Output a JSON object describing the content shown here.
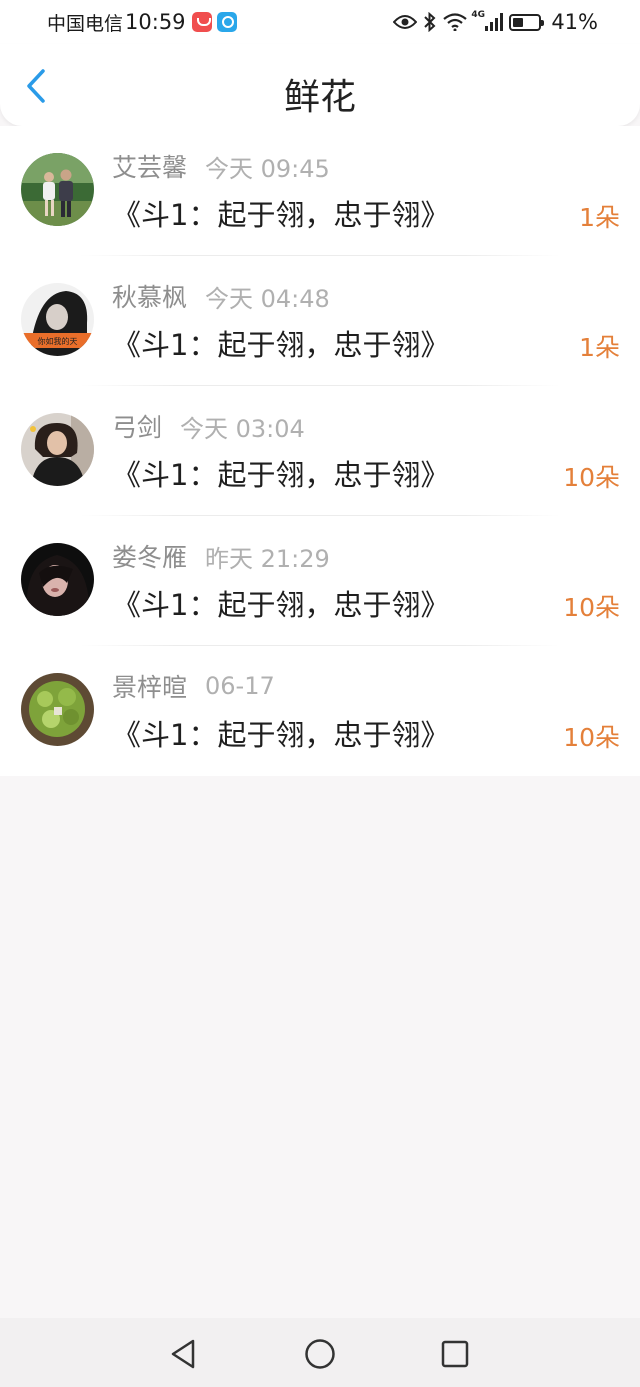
{
  "status_bar": {
    "carrier": "中国电信",
    "time": "10:59",
    "network": "4G",
    "battery_percent": "41%",
    "battery_level": 0.41
  },
  "header": {
    "title": "鲜花",
    "back_icon": "chevron-left-icon"
  },
  "colors": {
    "accent_blue": "#2a9be8",
    "quantity_orange": "#e4803a"
  },
  "gifts": [
    {
      "sender": "艾芸馨",
      "time": "今天 09:45",
      "book": "《斗1：起于翎，忠于翎》",
      "quantity": "1朵"
    },
    {
      "sender": "秋慕枫",
      "time": "今天 04:48",
      "book": "《斗1：起于翎，忠于翎》",
      "quantity": "1朵"
    },
    {
      "sender": "弓剑",
      "time": "今天 03:04",
      "book": "《斗1：起于翎，忠于翎》",
      "quantity": "10朵"
    },
    {
      "sender": "娄冬雁",
      "time": "昨天 21:29",
      "book": "《斗1：起于翎，忠于翎》",
      "quantity": "10朵"
    },
    {
      "sender": "景梓暄",
      "time": "06-17",
      "book": "《斗1：起于翎，忠于翎》",
      "quantity": "10朵"
    }
  ],
  "avatar_caption": "你如我的天",
  "nav_bar": {
    "back_icon": "triangle-back-icon",
    "home_icon": "circle-home-icon",
    "recents_icon": "square-recents-icon"
  }
}
